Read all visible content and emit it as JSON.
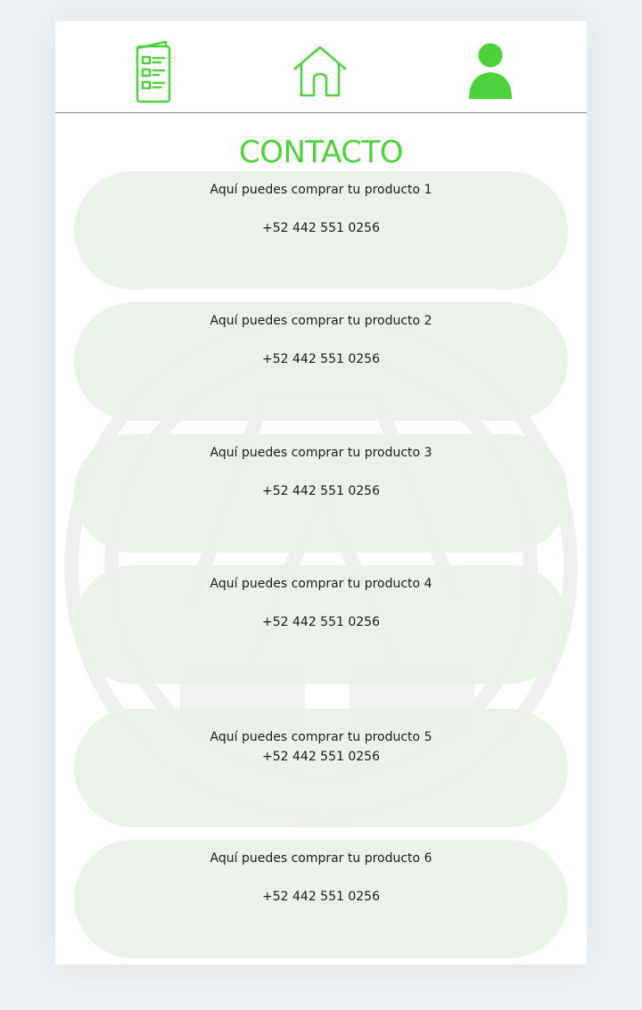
{
  "nav": {
    "items": [
      {
        "icon": "menu-list-icon",
        "label": ""
      },
      {
        "icon": "home-icon",
        "label": ""
      },
      {
        "icon": "user-profile-icon",
        "label": ""
      }
    ]
  },
  "page": {
    "title": "CONTACTO"
  },
  "contacts": [
    {
      "label": "Aquí puedes comprar tu producto 1",
      "phone": "+52 442 551 0256"
    },
    {
      "label": "Aquí puedes comprar tu producto 2",
      "phone": "+52 442 551 0256"
    },
    {
      "label": "Aquí puedes comprar tu producto 3",
      "phone": "+52 442 551 0256"
    },
    {
      "label": "Aquí puedes comprar tu producto 4",
      "phone": "+52 442 551 0256"
    },
    {
      "label": "Aquí puedes comprar tu producto 5",
      "phone": "+52 442 551 0256"
    },
    {
      "label": "Aquí puedes comprar tu producto 6",
      "phone": "+52 442 551 0256"
    }
  ],
  "colors": {
    "accent": "#4cd33b",
    "card_bg": "#e8f2e6",
    "page_bg": "#edf0f4"
  }
}
